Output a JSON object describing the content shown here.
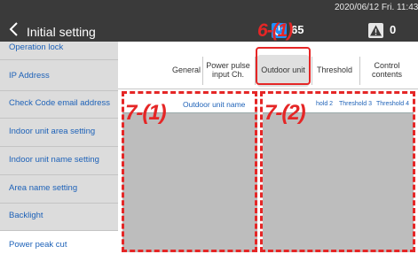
{
  "header": {
    "title": "Initial setting",
    "datetime": "2020/06/12 Fri. 11:43",
    "power_count": "65",
    "alert_count": "0"
  },
  "sidebar": {
    "items": [
      {
        "label": "Operation lock"
      },
      {
        "label": "IP Address"
      },
      {
        "label": "Check Code email address"
      },
      {
        "label": "Indoor unit area setting"
      },
      {
        "label": "Indoor unit name setting"
      },
      {
        "label": "Area name setting"
      },
      {
        "label": "Backlight"
      },
      {
        "label": "Power peak cut"
      }
    ]
  },
  "tabs": [
    {
      "label": "General"
    },
    {
      "label": "Power pulse input Ch."
    },
    {
      "label": "Outdoor unit"
    },
    {
      "label": "Threshold"
    },
    {
      "label": "Control contents"
    }
  ],
  "table_left": {
    "headers": [
      "Outdoor unit name"
    ]
  },
  "table_right": {
    "headers": [
      "hold 2",
      "Threshold 3",
      "Threshold 4"
    ]
  },
  "annotations": {
    "tab_callout": "6-(1)",
    "left_callout": "7-(1)",
    "right_callout": "7-(2)"
  },
  "colors": {
    "header_bg": "#3a3a3a",
    "accent_blue": "#1e62b8",
    "annotation_red": "#e52626"
  }
}
